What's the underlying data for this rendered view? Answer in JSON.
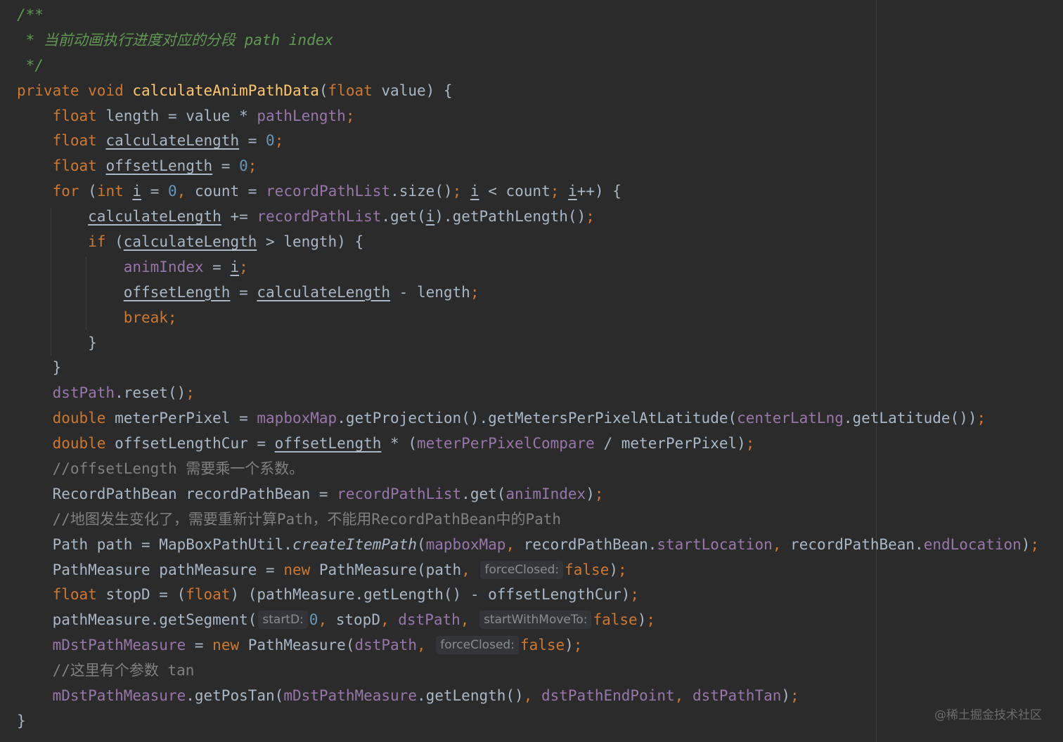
{
  "editor": {
    "watermark": "@稀土掘金技术社区"
  },
  "code_lines": [
    [
      {
        "t": "/**",
        "c": "doc"
      }
    ],
    [
      {
        "t": " * 当前动画执行进度对应的分段 path index",
        "c": "doc"
      }
    ],
    [
      {
        "t": " */",
        "c": "doc"
      }
    ],
    [
      {
        "t": "private void ",
        "c": "kw"
      },
      {
        "t": "calculateAnimPathData",
        "c": "fn"
      },
      {
        "t": "(",
        "c": "pl"
      },
      {
        "t": "float ",
        "c": "kw"
      },
      {
        "t": "value) {",
        "c": "pl"
      }
    ],
    [
      {
        "t": "    "
      },
      {
        "t": "float ",
        "c": "kw"
      },
      {
        "t": "length = value * ",
        "c": "pl"
      },
      {
        "t": "pathLength",
        "c": "fld"
      },
      {
        "t": ";",
        "c": "kw"
      }
    ],
    [
      {
        "t": "    "
      },
      {
        "t": "float ",
        "c": "kw"
      },
      {
        "t": "calculateLength",
        "c": "pl u"
      },
      {
        "t": " = ",
        "c": "pl"
      },
      {
        "t": "0",
        "c": "num"
      },
      {
        "t": ";",
        "c": "kw"
      }
    ],
    [
      {
        "t": "    "
      },
      {
        "t": "float ",
        "c": "kw"
      },
      {
        "t": "offsetLength",
        "c": "pl u"
      },
      {
        "t": " = ",
        "c": "pl"
      },
      {
        "t": "0",
        "c": "num"
      },
      {
        "t": ";",
        "c": "kw"
      }
    ],
    [
      {
        "t": "    "
      },
      {
        "t": "for ",
        "c": "kw"
      },
      {
        "t": "(",
        "c": "pl"
      },
      {
        "t": "int ",
        "c": "kw"
      },
      {
        "t": "i",
        "c": "pl u"
      },
      {
        "t": " = ",
        "c": "pl"
      },
      {
        "t": "0",
        "c": "num"
      },
      {
        "t": ", ",
        "c": "kw"
      },
      {
        "t": "count = ",
        "c": "pl"
      },
      {
        "t": "recordPathList",
        "c": "fld"
      },
      {
        "t": ".size()",
        "c": "pl"
      },
      {
        "t": "; ",
        "c": "kw"
      },
      {
        "t": "i",
        "c": "pl u"
      },
      {
        "t": " < count",
        "c": "pl"
      },
      {
        "t": "; ",
        "c": "kw"
      },
      {
        "t": "i",
        "c": "pl u"
      },
      {
        "t": "++) {",
        "c": "pl"
      }
    ],
    [
      {
        "t": "        "
      },
      {
        "t": "calculateLength",
        "c": "pl u"
      },
      {
        "t": " += ",
        "c": "pl"
      },
      {
        "t": "recordPathList",
        "c": "fld"
      },
      {
        "t": ".get(",
        "c": "pl"
      },
      {
        "t": "i",
        "c": "pl u"
      },
      {
        "t": ").getPathLength()",
        "c": "pl"
      },
      {
        "t": ";",
        "c": "kw"
      }
    ],
    [
      {
        "t": "        "
      },
      {
        "t": "if ",
        "c": "kw"
      },
      {
        "t": "(",
        "c": "pl"
      },
      {
        "t": "calculateLength",
        "c": "pl u"
      },
      {
        "t": " > length) {",
        "c": "pl"
      }
    ],
    [
      {
        "t": "            "
      },
      {
        "t": "animIndex",
        "c": "fld"
      },
      {
        "t": " = ",
        "c": "pl"
      },
      {
        "t": "i",
        "c": "pl u"
      },
      {
        "t": ";",
        "c": "kw"
      }
    ],
    [
      {
        "t": "            "
      },
      {
        "t": "offsetLength",
        "c": "pl u"
      },
      {
        "t": " = ",
        "c": "pl"
      },
      {
        "t": "calculateLength",
        "c": "pl u"
      },
      {
        "t": " - length",
        "c": "pl"
      },
      {
        "t": ";",
        "c": "kw"
      }
    ],
    [
      {
        "t": "            "
      },
      {
        "t": "break;",
        "c": "kw"
      }
    ],
    [
      {
        "t": "        "
      },
      {
        "t": "}",
        "c": "pl"
      }
    ],
    [
      {
        "t": "    "
      },
      {
        "t": "}",
        "c": "pl"
      }
    ],
    [
      {
        "t": "    "
      },
      {
        "t": "dstPath",
        "c": "fld"
      },
      {
        "t": ".reset()",
        "c": "pl"
      },
      {
        "t": ";",
        "c": "kw"
      }
    ],
    [
      {
        "t": "    "
      },
      {
        "t": "double ",
        "c": "kw"
      },
      {
        "t": "meterPerPixel = ",
        "c": "pl"
      },
      {
        "t": "mapboxMap",
        "c": "fld"
      },
      {
        "t": ".getProjection().getMetersPerPixelAtLatitude(",
        "c": "pl"
      },
      {
        "t": "centerLatLng",
        "c": "fld"
      },
      {
        "t": ".getLatitude())",
        "c": "pl"
      },
      {
        "t": ";",
        "c": "kw"
      }
    ],
    [
      {
        "t": "    "
      },
      {
        "t": "double ",
        "c": "kw"
      },
      {
        "t": "offsetLengthCur = ",
        "c": "pl"
      },
      {
        "t": "offsetLength",
        "c": "pl u"
      },
      {
        "t": " * (",
        "c": "pl"
      },
      {
        "t": "meterPerPixelCompare",
        "c": "fld"
      },
      {
        "t": " / meterPerPixel)",
        "c": "pl"
      },
      {
        "t": ";",
        "c": "kw"
      }
    ],
    [
      {
        "t": "    "
      },
      {
        "t": "//offsetLength 需要乘一个系数。",
        "c": "com"
      }
    ],
    [
      {
        "t": "    "
      },
      {
        "t": "RecordPathBean recordPathBean = ",
        "c": "pl"
      },
      {
        "t": "recordPathList",
        "c": "fld"
      },
      {
        "t": ".get(",
        "c": "pl"
      },
      {
        "t": "animIndex",
        "c": "fld"
      },
      {
        "t": ")",
        "c": "pl"
      },
      {
        "t": ";",
        "c": "kw"
      }
    ],
    [
      {
        "t": "    "
      },
      {
        "t": "//地图发生变化了，需要重新计算Path，不能用RecordPathBean中的Path",
        "c": "com"
      }
    ],
    [
      {
        "t": "    "
      },
      {
        "t": "Path path = MapBoxPathUtil.",
        "c": "pl"
      },
      {
        "t": "createItemPath",
        "c": "pl it"
      },
      {
        "t": "(",
        "c": "pl"
      },
      {
        "t": "mapboxMap",
        "c": "fld"
      },
      {
        "t": ", ",
        "c": "kw"
      },
      {
        "t": "recordPathBean.",
        "c": "pl"
      },
      {
        "t": "startLocation",
        "c": "fld"
      },
      {
        "t": ", ",
        "c": "kw"
      },
      {
        "t": "recordPathBean.",
        "c": "pl"
      },
      {
        "t": "endLocation",
        "c": "fld"
      },
      {
        "t": ")",
        "c": "pl"
      },
      {
        "t": ";",
        "c": "kw"
      }
    ],
    [
      {
        "t": "    "
      },
      {
        "t": "PathMeasure pathMeasure = ",
        "c": "pl"
      },
      {
        "t": "new ",
        "c": "kw"
      },
      {
        "t": "PathMeasure(path",
        "c": "pl"
      },
      {
        "t": ", ",
        "c": "kw"
      },
      {
        "hint": "forceClosed:"
      },
      {
        "t": "false",
        "c": "kw"
      },
      {
        "t": ")",
        "c": "pl"
      },
      {
        "t": ";",
        "c": "kw"
      }
    ],
    [
      {
        "t": "    "
      },
      {
        "t": "float ",
        "c": "kw"
      },
      {
        "t": "stopD = (",
        "c": "pl"
      },
      {
        "t": "float",
        "c": "kw"
      },
      {
        "t": ") (pathMeasure.getLength() - offsetLengthCur)",
        "c": "pl"
      },
      {
        "t": ";",
        "c": "kw"
      }
    ],
    [
      {
        "t": "    "
      },
      {
        "t": "pathMeasure.getSegment(",
        "c": "pl"
      },
      {
        "hint": "startD:"
      },
      {
        "t": "0",
        "c": "num"
      },
      {
        "t": ", ",
        "c": "kw"
      },
      {
        "t": "stopD",
        "c": "pl"
      },
      {
        "t": ", ",
        "c": "kw"
      },
      {
        "t": "dstPath",
        "c": "fld"
      },
      {
        "t": ", ",
        "c": "kw"
      },
      {
        "hint": "startWithMoveTo:"
      },
      {
        "t": "false",
        "c": "kw"
      },
      {
        "t": ")",
        "c": "pl"
      },
      {
        "t": ";",
        "c": "kw"
      }
    ],
    [
      {
        "t": "    "
      },
      {
        "t": "mDstPathMeasure",
        "c": "fld"
      },
      {
        "t": " = ",
        "c": "pl"
      },
      {
        "t": "new ",
        "c": "kw"
      },
      {
        "t": "PathMeasure(",
        "c": "pl"
      },
      {
        "t": "dstPath",
        "c": "fld"
      },
      {
        "t": ", ",
        "c": "kw"
      },
      {
        "hint": "forceClosed:"
      },
      {
        "t": "false",
        "c": "kw"
      },
      {
        "t": ")",
        "c": "pl"
      },
      {
        "t": ";",
        "c": "kw"
      }
    ],
    [
      {
        "t": "    "
      },
      {
        "t": "//这里有个参数 tan",
        "c": "com"
      }
    ],
    [
      {
        "t": "    "
      },
      {
        "t": "mDstPathMeasure",
        "c": "fld"
      },
      {
        "t": ".getPosTan(",
        "c": "pl"
      },
      {
        "t": "mDstPathMeasure",
        "c": "fld"
      },
      {
        "t": ".getLength()",
        "c": "pl"
      },
      {
        "t": ", ",
        "c": "kw"
      },
      {
        "t": "dstPathEndPoint",
        "c": "fld"
      },
      {
        "t": ", ",
        "c": "kw"
      },
      {
        "t": "dstPathTan",
        "c": "fld"
      },
      {
        "t": ")",
        "c": "pl"
      },
      {
        "t": ";",
        "c": "kw"
      }
    ],
    [
      {
        "t": "}",
        "c": "pl"
      }
    ]
  ]
}
